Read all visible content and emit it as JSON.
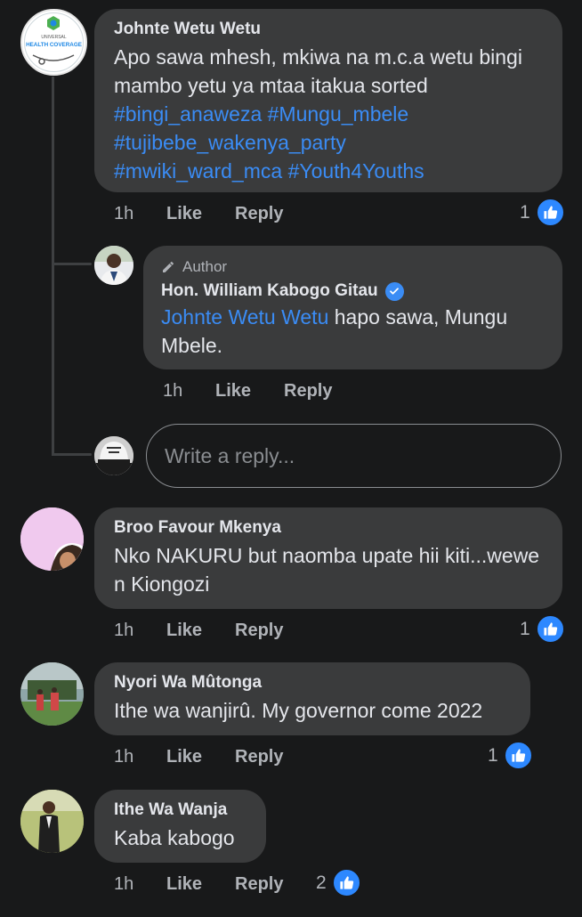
{
  "comments": [
    {
      "name": "Johnte Wetu Wetu",
      "text_plain": "Apo sawa mhesh, mkiwa na m.c.a wetu bingi mambo yetu ya mtaa itakua sorted",
      "tags": [
        "#bingi_anaweza",
        "#Mungu_mbele",
        "#tujibebe_wakenya_party",
        "#mwiki_ward_mca",
        "#Youth4Youths"
      ],
      "time": "1h",
      "like": "Like",
      "reply": "Reply",
      "reactions": "1",
      "avatar_text": [
        "UNIVERSAL",
        "HEALTH COVERAGE"
      ]
    },
    {
      "badge": "Author",
      "name": "Hon. William Kabogo Gitau",
      "mention": "Johnte Wetu Wetu",
      "text": " hapo sawa, Mungu Mbele.",
      "time": "1h",
      "like": "Like",
      "reply": "Reply"
    },
    {
      "name": "Broo Favour Mkenya",
      "text": "Nko NAKURU but naomba upate hii kiti...wewe n Kiongozi",
      "time": "1h",
      "like": "Like",
      "reply": "Reply",
      "reactions": "1"
    },
    {
      "name": "Nyori Wa Mûtonga",
      "text": "Ithe wa wanjirû. My governor come 2022",
      "time": "1h",
      "like": "Like",
      "reply": "Reply",
      "reactions": "1"
    },
    {
      "name": "Ithe Wa Wanja",
      "text": "Kaba kabogo",
      "time": "1h",
      "like": "Like",
      "reply": "Reply",
      "reactions": "2"
    }
  ],
  "reply_box": {
    "placeholder": "Write a reply..."
  },
  "colors": {
    "background": "#18191a",
    "bubble": "#3a3b3c",
    "link": "#3a8cf5",
    "like_blue": "#2d88ff"
  }
}
